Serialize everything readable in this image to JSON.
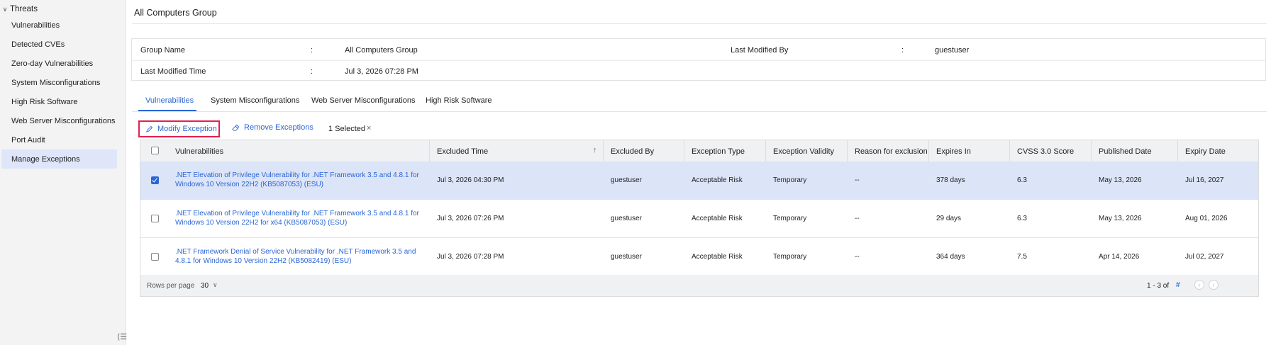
{
  "sidebar": {
    "group_label": "Threats",
    "items": [
      {
        "label": "Vulnerabilities"
      },
      {
        "label": "Detected CVEs"
      },
      {
        "label": "Zero-day Vulnerabilities"
      },
      {
        "label": "System Misconfigurations"
      },
      {
        "label": "High Risk Software"
      },
      {
        "label": "Web Server Misconfigurations"
      },
      {
        "label": "Port Audit"
      },
      {
        "label": "Manage Exceptions"
      }
    ],
    "active_item": "Manage Exceptions",
    "collapse_icon": "collapse-sidebar-icon"
  },
  "page": {
    "title": "All Computers Group"
  },
  "info": {
    "group_name_label": "Group Name",
    "group_name_value": "All Computers Group",
    "last_modified_by_label": "Last Modified By",
    "last_modified_by_value": "guestuser",
    "last_modified_time_label": "Last Modified Time",
    "last_modified_time_value": "Jul 3, 2026 07:28 PM",
    "separator": ":"
  },
  "tabs": [
    {
      "label": "Vulnerabilities"
    },
    {
      "label": "System Misconfigurations"
    },
    {
      "label": "Web Server Misconfigurations"
    },
    {
      "label": "High Risk Software"
    }
  ],
  "active_tab": "Vulnerabilities",
  "toolbar": {
    "modify_label": "Modify Exception",
    "remove_label": "Remove Exceptions",
    "selected_label": "1 Selected",
    "clear_glyph": "×"
  },
  "table": {
    "headers": {
      "vulnerabilities": "Vulnerabilities",
      "excluded_time": "Excluded Time",
      "excluded_by": "Excluded By",
      "exception_type": "Exception Type",
      "exception_validity": "Exception Validity",
      "reason": "Reason for exclusion",
      "expires_in": "Expires In",
      "cvss": "CVSS 3.0 Score",
      "published_date": "Published Date",
      "expiry_date": "Expiry Date"
    },
    "sort_indicator": "↑",
    "rows": [
      {
        "checked": true,
        "vulnerability": ".NET Elevation of Privilege Vulnerability for .NET Framework 3.5 and 4.8.1 for Windows 10 Version 22H2 (KB5087053) (ESU)",
        "excluded_time": "Jul 3, 2026 04:30 PM",
        "excluded_by": "guestuser",
        "exception_type": "Acceptable Risk",
        "exception_validity": "Temporary",
        "reason": "--",
        "expires_in": "378 days",
        "cvss": "6.3",
        "published_date": "May 13, 2026",
        "expiry_date": "Jul 16, 2027"
      },
      {
        "checked": false,
        "vulnerability": ".NET Elevation of Privilege Vulnerability for .NET Framework 3.5 and 4.8.1 for Windows 10 Version 22H2 for x64 (KB5087053) (ESU)",
        "excluded_time": "Jul 3, 2026 07:26 PM",
        "excluded_by": "guestuser",
        "exception_type": "Acceptable Risk",
        "exception_validity": "Temporary",
        "reason": "--",
        "expires_in": "29 days",
        "cvss": "6.3",
        "published_date": "May 13, 2026",
        "expiry_date": "Aug 01, 2026"
      },
      {
        "checked": false,
        "vulnerability": ".NET Framework Denial of Service Vulnerability for .NET Framework 3.5 and 4.8.1 for Windows 10 Version 22H2 (KB5082419) (ESU)",
        "excluded_time": "Jul 3, 2026 07:28 PM",
        "excluded_by": "guestuser",
        "exception_type": "Acceptable Risk",
        "exception_validity": "Temporary",
        "reason": "--",
        "expires_in": "364 days",
        "cvss": "7.5",
        "published_date": "Apr 14, 2026",
        "expiry_date": "Jul 02, 2027"
      }
    ]
  },
  "footer": {
    "rows_per_page_label": "Rows per page",
    "rows_per_page_value": "30",
    "range_label": "1 - 3 of",
    "total_label": "#"
  },
  "colors": {
    "accent": "#2a66d6",
    "highlight_border": "#e4204f",
    "selected_row": "#dce4f7",
    "sidebar_active": "#dfe6fa"
  }
}
